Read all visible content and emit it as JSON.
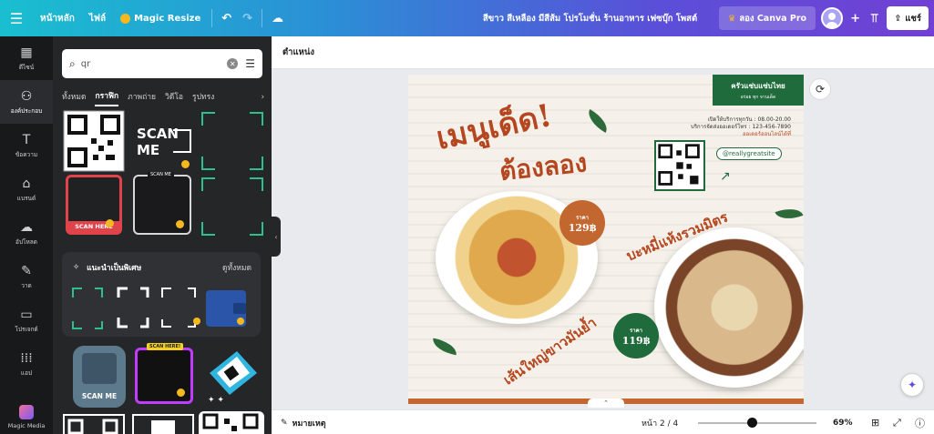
{
  "topbar": {
    "menu_icon": "hamburger-icon",
    "home": "หน้าหลัก",
    "file": "ไฟล์",
    "magic_resize": "Magic Resize",
    "undo_icon": "undo-icon",
    "redo_icon": "redo-icon",
    "cloud_icon": "cloud-save-icon",
    "doc_title": "สีขาว สีเหลือง มีสีส้ม โปรโมชั่น ร้านอาหาร เฟซบุ๊ก โพสต์",
    "pro_button": "ลอง Canva Pro",
    "analytics_icon": "bar-chart-icon",
    "share_label": "แชร์",
    "gradient_start": "#19bfd0",
    "gradient_end": "#7140d4"
  },
  "rail": {
    "items": [
      {
        "icon": "template-icon",
        "label": "ดีไซน์"
      },
      {
        "icon": "elements-icon",
        "label": "องค์ประกอบ"
      },
      {
        "icon": "text-icon",
        "label": "ข้อความ"
      },
      {
        "icon": "brand-icon",
        "label": "แบรนด์"
      },
      {
        "icon": "upload-icon",
        "label": "อัปโหลด"
      },
      {
        "icon": "draw-icon",
        "label": "วาด"
      },
      {
        "icon": "folder-icon",
        "label": "โปรเจกต์"
      },
      {
        "icon": "apps-icon",
        "label": "แอป"
      }
    ],
    "magic_media": "Magic Media"
  },
  "panel": {
    "search_value": "qr",
    "tabs": [
      "ทั้งหมด",
      "กราฟิก",
      "ภาพถ่าย",
      "วิดีโอ",
      "รูปทรง"
    ],
    "active_tab": "กราฟิก",
    "tile_text_scan_me": "SCAN ME",
    "tile_text_scan_here": "SCAN HERE",
    "feature_title": "แนะนำเป็นพิเศษ",
    "feature_see_all": "ดูทั้งหมด",
    "tile_text_scan_here_bang": "SCAN HERE!"
  },
  "workspace": {
    "toolbar_label": "ตำแหน่ง",
    "design": {
      "banner_main": "ครัวแซ่บแซ่บไทย",
      "banner_sub": "อร่อย ทุก จานเด็ด",
      "headline1": "เมนูเด็ด!",
      "headline2": "ต้องลอง",
      "hours": "เปิดให้บริการทุกวัน : 08.00-20.00",
      "order": "บริการจัดส่งออเดอร์โทร : 123-456-7890",
      "order_link": "ออเดอร์ออนไลน์ได้ที่",
      "social": "@reallygreatsite",
      "price1_label": "ราคา",
      "price1_value": "129฿",
      "price2_label": "ราคา",
      "price2_value": "119฿",
      "curve1": "บะหมี่แห้งรวมมิตร",
      "curve2": "เส้นใหญ่ขาวมันย้ำ"
    }
  },
  "bottombar": {
    "notes": "หมายเหตุ",
    "page_info": "หน้า 2 / 4",
    "zoom": "69%",
    "zoom_fraction": 0.46
  }
}
